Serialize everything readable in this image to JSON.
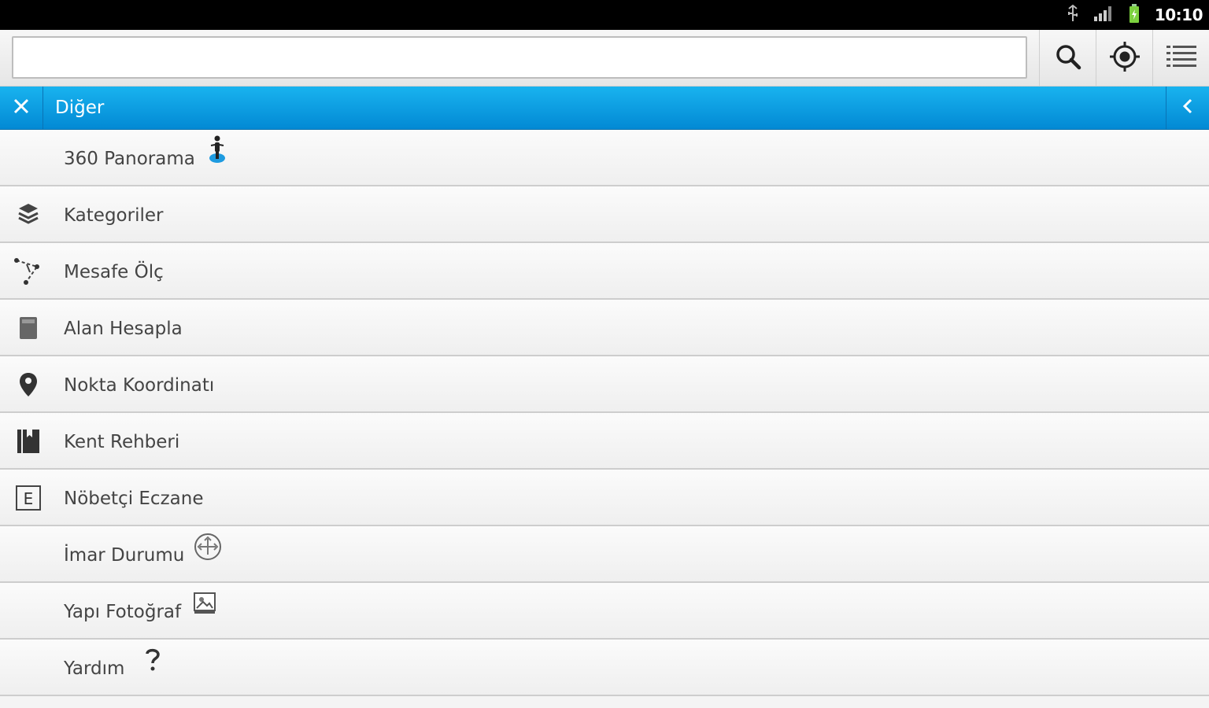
{
  "status_bar": {
    "time": "10:10",
    "icons": [
      "usb-icon",
      "signal-icon",
      "battery-icon"
    ]
  },
  "toolbar": {
    "search_value": "",
    "search_placeholder": "",
    "buttons": [
      "search-icon",
      "locate-icon",
      "menu-list-icon"
    ]
  },
  "header": {
    "title": "Diğer",
    "accent_color": "#0a9fe3"
  },
  "menu": {
    "items": [
      {
        "label": "360 Panorama",
        "icon": "pegman-icon"
      },
      {
        "label": "Kategoriler",
        "icon": "layers-icon"
      },
      {
        "label": "Mesafe Ölç",
        "icon": "measure-distance-icon"
      },
      {
        "label": "Alan Hesapla",
        "icon": "area-icon"
      },
      {
        "label": "Nokta Koordinatı",
        "icon": "location-pin-icon"
      },
      {
        "label": "Kent Rehberi",
        "icon": "city-guide-icon"
      },
      {
        "label": "Nöbetçi Eczane",
        "icon": "pharmacy-e-icon"
      },
      {
        "label": "İmar Durumu",
        "icon": "zoning-icon"
      },
      {
        "label": "Yapı Fotoğraf",
        "icon": "photo-icon"
      },
      {
        "label": "Yardım",
        "icon": "help-question-icon"
      }
    ]
  }
}
